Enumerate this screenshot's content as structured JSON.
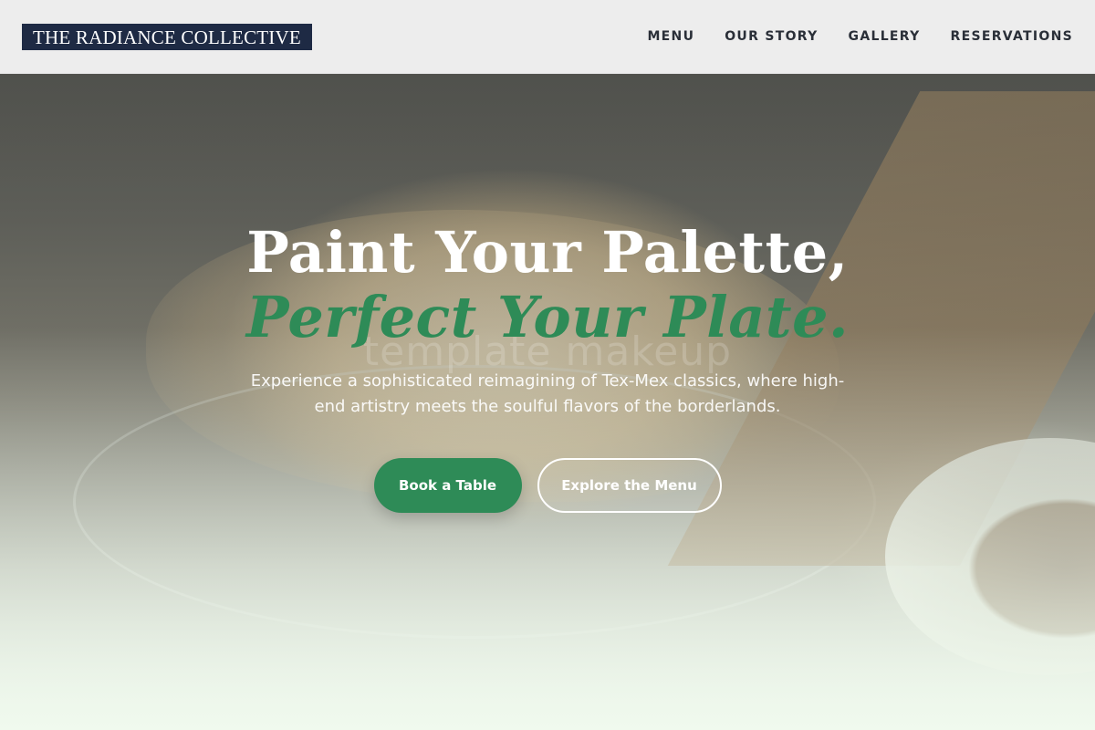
{
  "brand": {
    "name": "THE RADIANCE COLLECTIVE"
  },
  "nav": {
    "items": [
      {
        "label": "MENU"
      },
      {
        "label": "OUR STORY"
      },
      {
        "label": "GALLERY"
      },
      {
        "label": "RESERVATIONS"
      }
    ]
  },
  "hero": {
    "title_line1": "Paint Your Palette,",
    "title_line2": "Perfect Your Plate.",
    "subtitle": "Experience a sophisticated reimagining of Tex-Mex classics, where high-end artistry meets the soulful flavors of the borderlands.",
    "watermark": "template makeup",
    "primary_button": "Book a Table",
    "secondary_button": "Explore the Menu"
  },
  "colors": {
    "accent_green": "#2e8b57",
    "logo_background": "#1e2a44",
    "header_background": "#f4f4f4"
  }
}
